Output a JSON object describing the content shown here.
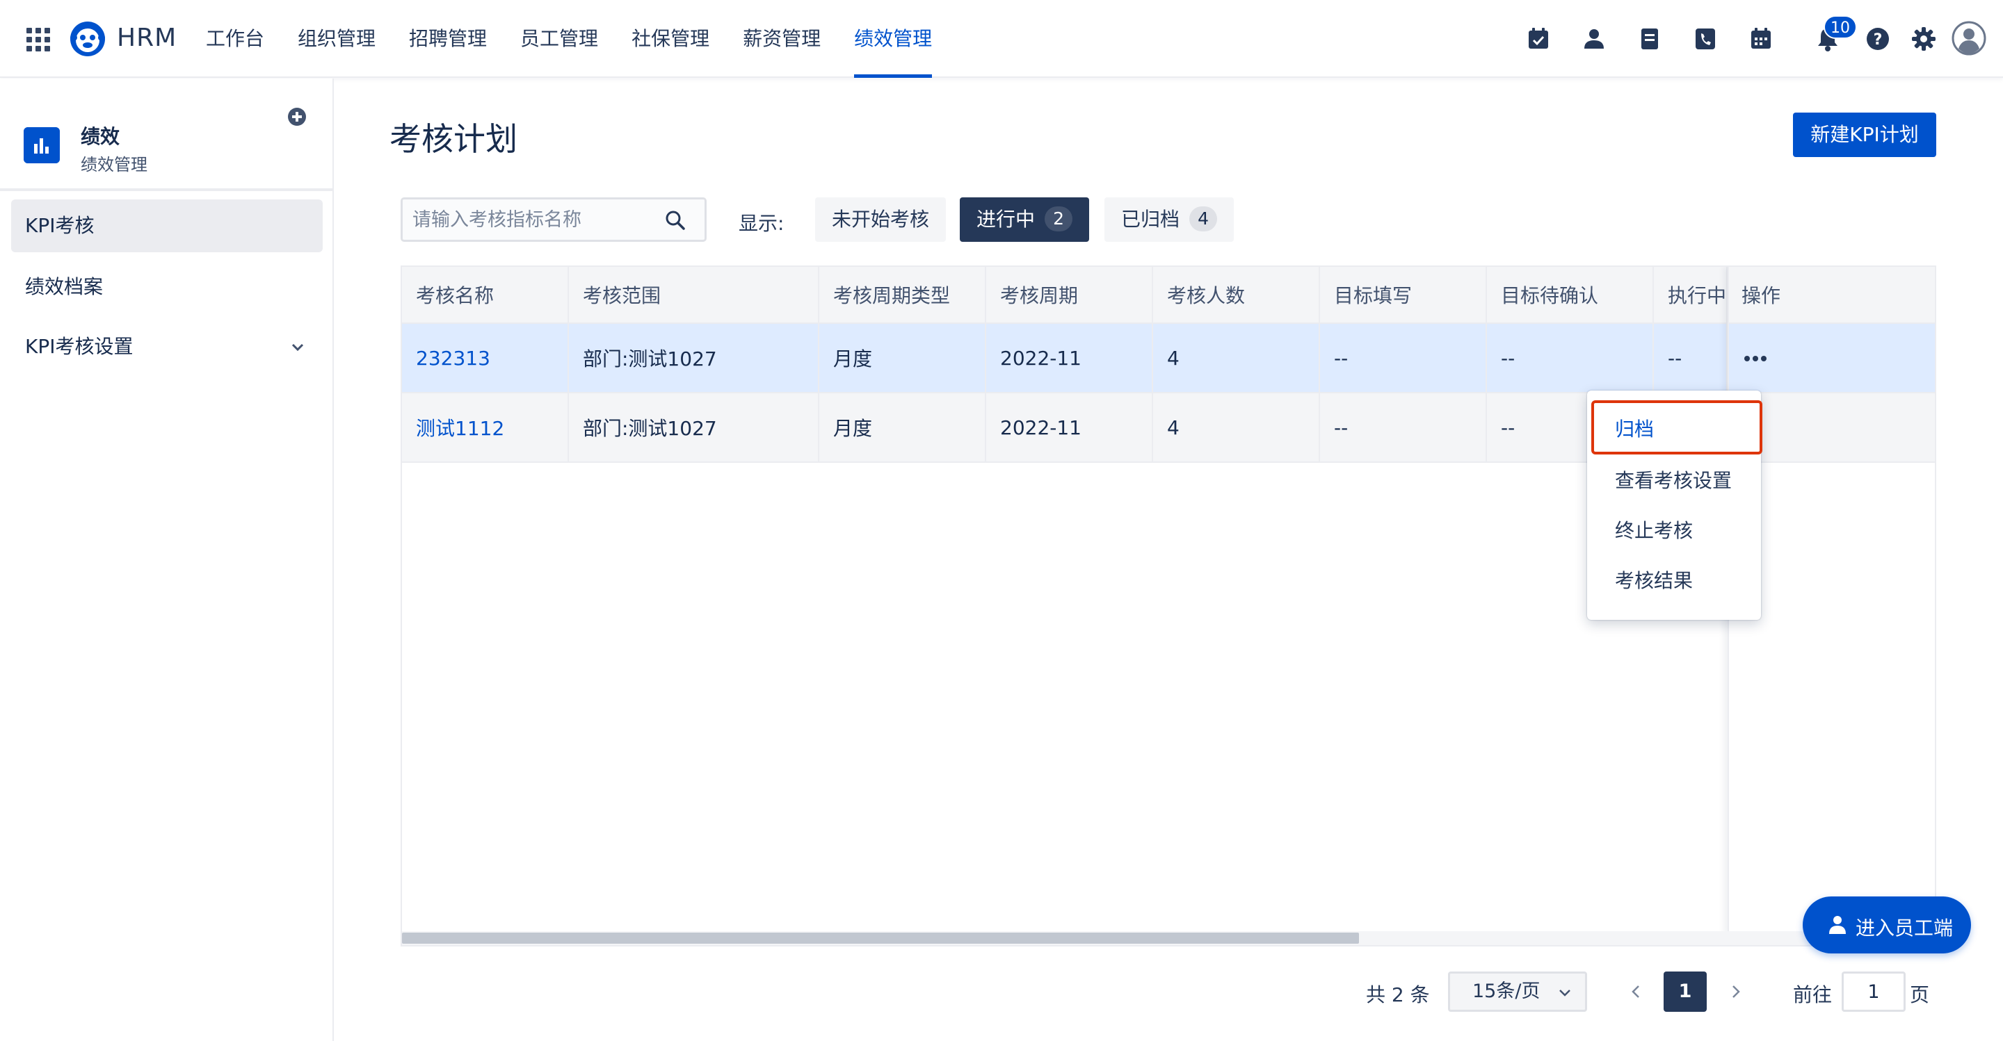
{
  "app": {
    "brand": "HRM",
    "nav": [
      "工作台",
      "组织管理",
      "招聘管理",
      "员工管理",
      "社保管理",
      "薪资管理",
      "绩效管理"
    ],
    "active_nav": "绩效管理",
    "notification_count": "10",
    "toolbar_icons": [
      "calendar-check-icon",
      "person-icon",
      "document-icon",
      "phone-icon",
      "calendar-icon",
      "bell-icon",
      "help-icon",
      "gear-icon",
      "user-avatar-icon"
    ]
  },
  "sidebar": {
    "module_title": "绩效",
    "module_sub": "绩效管理",
    "items": [
      {
        "label": "KPI考核",
        "active": true
      },
      {
        "label": "绩效档案",
        "active": false
      },
      {
        "label": "KPI考核设置",
        "active": false,
        "expandable": true
      }
    ]
  },
  "main": {
    "title": "考核计划",
    "new_button": "新建KPI计划",
    "search_placeholder": "请输入考核指标名称",
    "show_label": "显示:",
    "filters": [
      {
        "label": "未开始考核",
        "count": "",
        "active": false
      },
      {
        "label": "进行中",
        "count": "2",
        "active": true
      },
      {
        "label": "已归档",
        "count": "4",
        "active": false
      }
    ],
    "table": {
      "headers": [
        "考核名称",
        "考核范围",
        "考核周期类型",
        "考核周期",
        "考核人数",
        "目标填写",
        "目标待确认",
        "执行中",
        "操作"
      ],
      "rows": [
        [
          "232313",
          "部门:测试1027",
          "月度",
          "2022-11",
          "4",
          "--",
          "--",
          "--"
        ],
        [
          "测试1112",
          "部门:测试1027",
          "月度",
          "2022-11",
          "4",
          "--",
          "--",
          ""
        ]
      ]
    },
    "action_menu": [
      "归档",
      "查看考核设置",
      "终止考核",
      "考核结果"
    ],
    "highlighted_action": "归档"
  },
  "pagination": {
    "total_text": "共 2 条",
    "page_size": "15条/页",
    "current_page": "1",
    "goto_prefix": "前往",
    "goto_value": "1",
    "goto_suffix": "页"
  },
  "float_button": "进入员工端",
  "colors": {
    "primary": "#0052cc",
    "dark": "#253858",
    "highlight_border": "#de350b",
    "row_selected": "#deebff"
  }
}
